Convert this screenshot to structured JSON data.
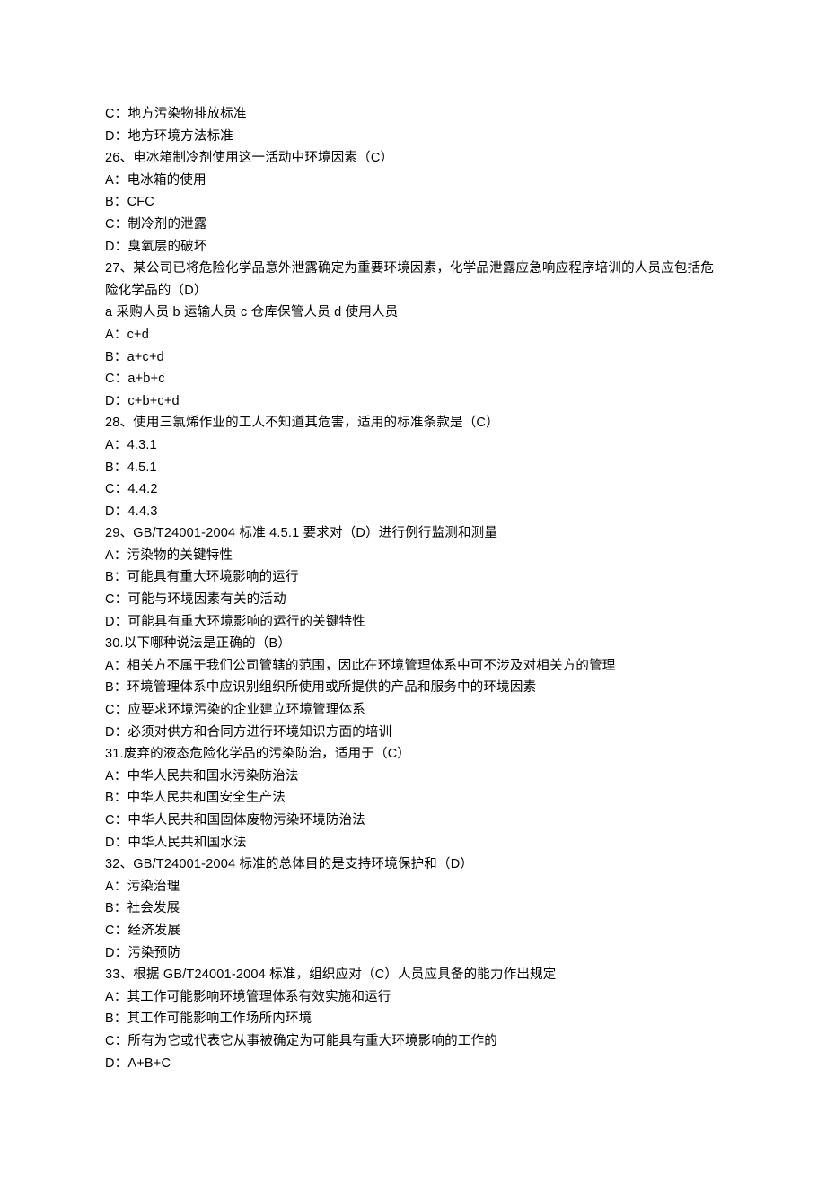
{
  "lines": [
    "C：地方污染物排放标准",
    "D：地方环境方法标准",
    "26、电冰箱制冷剂使用这一活动中环境因素（C）",
    "A：电冰箱的使用",
    "B：CFC",
    "C：制冷剂的泄露",
    "D：臭氧层的破坏",
    "27、某公司已将危险化学品意外泄露确定为重要环境因素，化学品泄露应急响应程序培训的人员应包括危险化学品的（D）",
    "a 采购人员  b 运输人员  c 仓库保管人员  d 使用人员",
    "A：c+d",
    "B：a+c+d",
    "C：a+b+c",
    "D：c+b+c+d",
    "28、使用三氯烯作业的工人不知道其危害，适用的标准条款是（C）",
    "A：4.3.1",
    "B：4.5.1",
    "C：4.4.2",
    "D：4.4.3",
    "29、GB/T24001-2004 标准 4.5.1 要求对（D）进行例行监测和测量",
    "A：污染物的关键特性",
    "B：可能具有重大环境影响的运行",
    "C：可能与环境因素有关的活动",
    "D：可能具有重大环境影响的运行的关键特性",
    "30.以下哪种说法是正确的（B）",
    "A：相关方不属于我们公司管辖的范围，因此在环境管理体系中可不涉及对相关方的管理",
    "B：环境管理体系中应识别组织所使用或所提供的产品和服务中的环境因素",
    "C：应要求环境污染的企业建立环境管理体系",
    "D：必须对供方和合同方进行环境知识方面的培训",
    "31.废弃的液态危险化学品的污染防治，适用于（C）",
    "A：中华人民共和国水污染防治法",
    "B：中华人民共和国安全生产法",
    "C：中华人民共和国固体废物污染环境防治法",
    "D：中华人民共和国水法",
    "32、GB/T24001-2004 标准的总体目的是支持环境保护和（D）",
    "A：污染治理",
    "B：社会发展",
    "C：经济发展",
    "D：污染预防",
    "33、根据 GB/T24001-2004 标准，组织应对（C）人员应具备的能力作出规定",
    "A：其工作可能影响环境管理体系有效实施和运行",
    "B：其工作可能影响工作场所内环境",
    "C：所有为它或代表它从事被确定为可能具有重大环境影响的工作的",
    "D：A+B+C"
  ]
}
